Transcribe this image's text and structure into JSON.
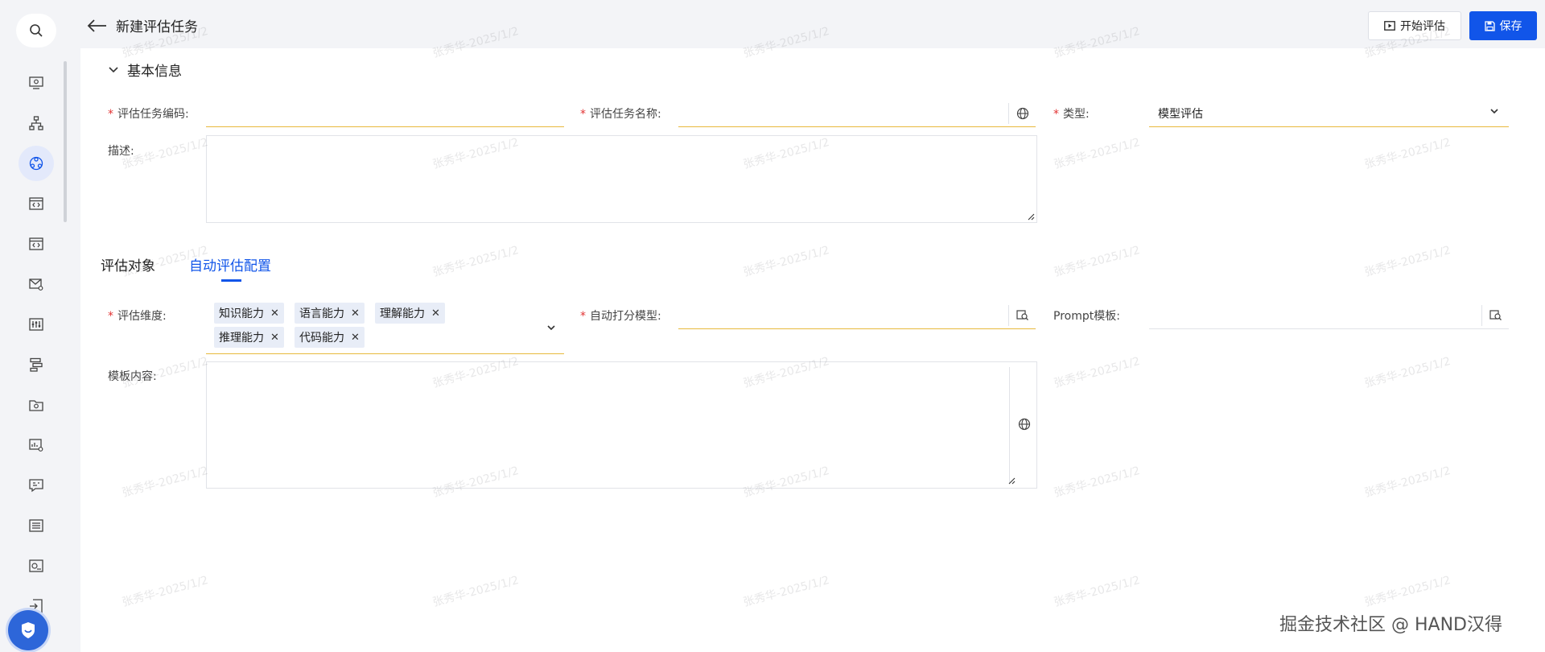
{
  "header": {
    "title": "新建评估任务",
    "start_label": "开始评估",
    "save_label": "保存"
  },
  "sidebar": {
    "items": [
      {
        "icon": "monitor-settings-icon"
      },
      {
        "icon": "org-tree-icon"
      },
      {
        "icon": "model-hub-icon",
        "active": true
      },
      {
        "icon": "code-window-icon"
      },
      {
        "icon": "code-window-alt-icon"
      },
      {
        "icon": "mail-settings-icon"
      },
      {
        "icon": "sliders-icon"
      },
      {
        "icon": "flow-chart-icon"
      },
      {
        "icon": "folder-settings-icon"
      },
      {
        "icon": "dashboard-settings-icon"
      },
      {
        "icon": "chat-edit-icon"
      },
      {
        "icon": "list-form-icon"
      },
      {
        "icon": "pie-window-icon"
      },
      {
        "icon": "import-doc-icon"
      }
    ]
  },
  "basic_section": {
    "title": "基本信息"
  },
  "form": {
    "code_label": "评估任务编码:",
    "name_label": "评估任务名称:",
    "type_label": "类型:",
    "type_value": "模型评估",
    "desc_label": "描述:"
  },
  "tabs": {
    "tab1": "评估对象",
    "tab2": "自动评估配置"
  },
  "config": {
    "dimension_label": "评估维度:",
    "dimension_tags": [
      "知识能力",
      "语言能力",
      "理解能力",
      "推理能力",
      "代码能力"
    ],
    "scoring_model_label": "自动打分模型:",
    "prompt_label": "Prompt模板:",
    "template_content_label": "模板内容:"
  },
  "watermark": "张秀华-2025/1/2",
  "brand": "掘金技术社区 @ HAND汉得",
  "colors": {
    "primary": "#1155e9",
    "required": "#e23434",
    "focus_underline": "#e8b93d"
  }
}
